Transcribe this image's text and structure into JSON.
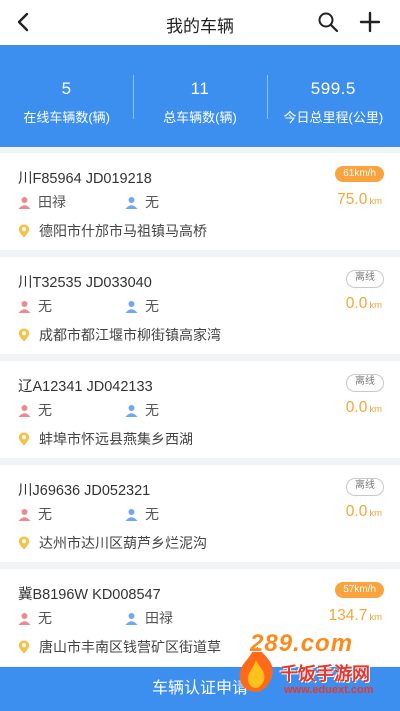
{
  "header": {
    "title": "我的车辆",
    "back_icon": "back-arrow-icon",
    "search_icon": "search-icon",
    "add_icon": "plus-icon"
  },
  "stats": [
    {
      "value": "5",
      "label": "在线车辆数(辆)"
    },
    {
      "value": "11",
      "label": "总车辆数(辆)"
    },
    {
      "value": "599.5",
      "label": "今日总里程(公里)"
    }
  ],
  "vehicles": [
    {
      "plate": "川F85964  JD019218",
      "status": "61km/h",
      "status_type": "speed",
      "person1": "田禄",
      "person2": "无",
      "distance": "75.0",
      "unit": "km",
      "address": "德阳市什邡市马祖镇马高桥"
    },
    {
      "plate": "川T32535  JD033040",
      "status": "离线",
      "status_type": "offline",
      "person1": "无",
      "person2": "无",
      "distance": "0.0",
      "unit": "km",
      "address": "成都市都江堰市柳街镇高家湾"
    },
    {
      "plate": "辽A12341  JD042133",
      "status": "离线",
      "status_type": "offline",
      "person1": "无",
      "person2": "无",
      "distance": "0.0",
      "unit": "km",
      "address": "蚌埠市怀远县燕集乡西湖"
    },
    {
      "plate": "川J69636  JD052321",
      "status": "离线",
      "status_type": "offline",
      "person1": "无",
      "person2": "无",
      "distance": "0.0",
      "unit": "km",
      "address": "达州市达川区葫芦乡烂泥沟"
    },
    {
      "plate": "冀B8196W  KD008547",
      "status": "57km/h",
      "status_type": "speed",
      "person1": "无",
      "person2": "田禄",
      "distance": "134.7",
      "unit": "km",
      "address": "唐山市丰南区钱营矿区街道草"
    }
  ],
  "bottom_button": "车辆认证申请",
  "watermark": {
    "brand": "289.com",
    "name": "千饭手游网",
    "url": "www.eduext.com"
  },
  "colors": {
    "primary": "#3d8fef",
    "speed_badge": "#fba33d",
    "distance": "#f5a63a",
    "person1_icon": "#f08a8a",
    "person2_icon": "#6fa8f0",
    "pin_icon": "#f5c24a"
  }
}
